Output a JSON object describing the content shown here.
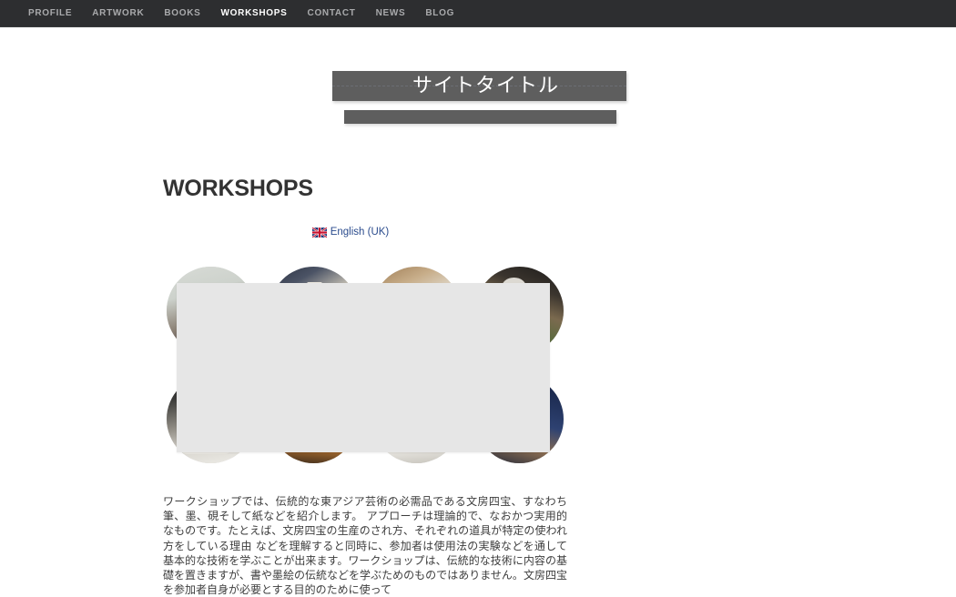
{
  "nav": {
    "items": [
      {
        "label": "PROFILE",
        "active": false
      },
      {
        "label": "ARTWORK",
        "active": false
      },
      {
        "label": "BOOKS",
        "active": false
      },
      {
        "label": "WORKSHOPS",
        "active": true
      },
      {
        "label": "CONTACT",
        "active": false
      },
      {
        "label": "NEWS",
        "active": false
      },
      {
        "label": "BLOG",
        "active": false
      }
    ],
    "background_color": "#2d2e30",
    "text_color": "#a9aaac",
    "active_text_color": "#ffffff"
  },
  "banner": {
    "site_title": "サイトタイトル",
    "bar_color": "#5e5e5e",
    "title_color": "#ffffff",
    "subtitle_bar_visible": true
  },
  "page": {
    "heading": "WORKSHOPS",
    "heading_color": "#333333"
  },
  "language_switcher": {
    "flag_icon": "uk-flag-icon",
    "label": "English (UK)",
    "link_color": "#2a4b8d"
  },
  "gallery": {
    "columns": 4,
    "rows": 2,
    "thumbnail_shape": "circle",
    "thumbnails": [
      {
        "id": "thumb-1",
        "alt": "workshop-participants-at-table"
      },
      {
        "id": "thumb-2",
        "alt": "studio-desk-with-materials"
      },
      {
        "id": "thumb-3",
        "alt": "instructor-demonstrating"
      },
      {
        "id": "thumb-4",
        "alt": "ink-grinding-bowls"
      },
      {
        "id": "thumb-5",
        "alt": "students-working-on-paper"
      },
      {
        "id": "thumb-6",
        "alt": "wooden-table-with-brushes"
      },
      {
        "id": "thumb-7",
        "alt": "newspaper-covered-worktop"
      },
      {
        "id": "thumb-8",
        "alt": "participants-practising-calligraphy"
      }
    ]
  },
  "overlay_panel": {
    "visible": true,
    "background_color": "#e6e6e6",
    "content": ""
  },
  "body": {
    "paragraph": "ワークショップでは、伝統的な東アジア芸術の必需品である文房四宝、すなわち筆、墨、硯そして紙などを紹介します。 アプローチは理論的で、なおかつ実用的なものです。たとえば、文房四宝の生産のされ方、それぞれの道具が特定の使われ方をしている理由 などを理解すると同時に、参加者は使用法の実験などを通して基本的な技術を学ぶことが出来ます。ワークショップは、伝統的な技術に内容の基礎を置きますが、書や墨絵の伝統などを学ぶためのものではありません。文房四宝を参加者自身が必要とする目的のために使って"
  }
}
